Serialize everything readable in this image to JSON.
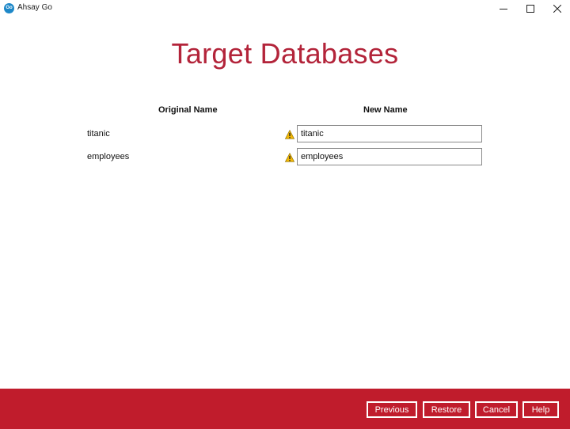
{
  "window": {
    "logo_text": "Go",
    "title": "Ahsay Go",
    "icons": [
      "minimize-icon",
      "maximize-icon",
      "close-icon"
    ]
  },
  "page": {
    "heading": "Target Databases"
  },
  "table": {
    "headers": {
      "original": "Original Name",
      "new": "New Name"
    },
    "rows": [
      {
        "original": "titanic",
        "new_value": "titanic",
        "icon": "warning-icon"
      },
      {
        "original": "employees",
        "new_value": "employees",
        "icon": "warning-icon"
      }
    ]
  },
  "footer": {
    "previous": "Previous",
    "restore": "Restore",
    "cancel": "Cancel",
    "help": "Help"
  },
  "colors": {
    "heading": "#b3243a",
    "footer_bg": "#c01c2c",
    "warning": "#f2b705"
  }
}
